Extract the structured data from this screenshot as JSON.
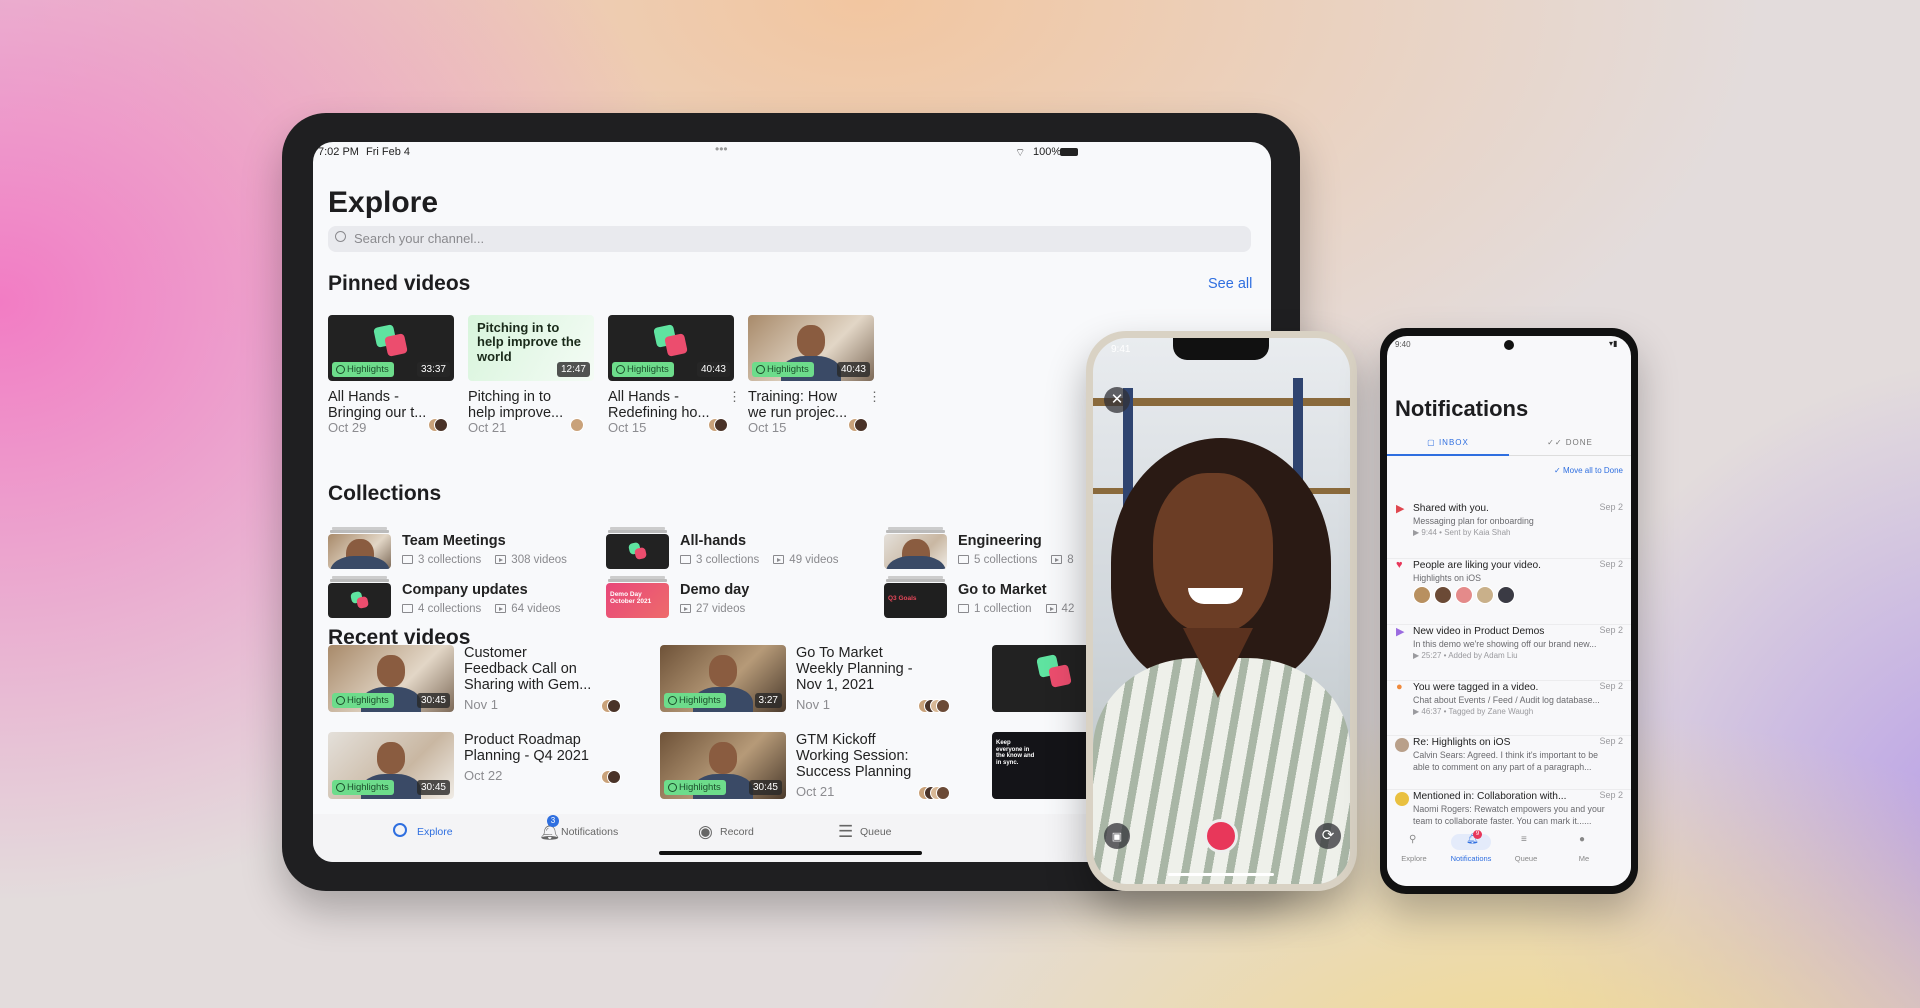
{
  "tablet": {
    "status": {
      "time": "7:02 PM",
      "date": "Fri Feb 4",
      "battery": "100%"
    },
    "title": "Explore",
    "search": {
      "placeholder": "Search your channel..."
    },
    "pinned": {
      "heading": "Pinned videos",
      "see_all": "See all",
      "items": [
        {
          "thumb": "logo",
          "badge": "Highlights",
          "duration": "33:37",
          "title": "All Hands -\nBringing our t...",
          "date": "Oct 29",
          "menu": false
        },
        {
          "thumb": "text",
          "thumb_text": "Pitching in to help improve the world",
          "duration": "12:47",
          "title": "Pitching in to\nhelp improve...",
          "date": "Oct 21",
          "menu": false
        },
        {
          "thumb": "logo",
          "badge": "Highlights",
          "duration": "40:43",
          "title": "All Hands -\nRedefining ho...",
          "date": "Oct 15",
          "menu": true
        },
        {
          "thumb": "photo",
          "badge": "Highlights",
          "duration": "40:43",
          "title": "Training: How\nwe run projec...",
          "date": "Oct 15",
          "menu": true
        }
      ]
    },
    "collections": {
      "heading": "Collections",
      "items": [
        {
          "name": "Team Meetings",
          "thumb": "photo",
          "collections": "3 collections",
          "videos": "308 videos"
        },
        {
          "name": "All-hands",
          "thumb": "logo",
          "collections": "3 collections",
          "videos": "49 videos"
        },
        {
          "name": "Engineering",
          "thumb": "photo-light",
          "collections": "5 collections",
          "videos": "8"
        },
        {
          "name": "Company updates",
          "thumb": "logo",
          "collections": "4 collections",
          "videos": "64 videos"
        },
        {
          "name": "Demo day",
          "thumb": "pink",
          "thumb_text": "Demo Day October 2021",
          "videos": "27 videos"
        },
        {
          "name": "Go to Market",
          "thumb": "dark-text",
          "thumb_text": "Q3 Goals",
          "collections": "1 collection",
          "videos": "42"
        }
      ]
    },
    "recent": {
      "heading": "Recent videos",
      "items": [
        {
          "thumb": "photo",
          "badge": "Highlights",
          "duration": "30:45",
          "title": "Customer\nFeedback Call on\nSharing with Gem...",
          "date": "Nov 1"
        },
        {
          "thumb": "photo-shelf",
          "badge": "Highlights",
          "duration": "3:27",
          "title": "Go To Market\nWeekly Planning -\nNov 1, 2021",
          "date": "Nov 1"
        },
        {
          "thumb": "logo"
        },
        {
          "thumb": "photo-light",
          "badge": "Highlights",
          "duration": "30:45",
          "title": "Product Roadmap\nPlanning - Q4 2021",
          "date": "Oct 22"
        },
        {
          "thumb": "photo-shelf",
          "badge": "Highlights",
          "duration": "30:45",
          "title": "GTM Kickoff\nWorking Session:\nSuccess Planning",
          "date": "Oct 21"
        },
        {
          "thumb": "promo",
          "thumb_text": "Keep everyone in the know and in sync."
        }
      ]
    },
    "tabbar": [
      {
        "label": "Explore",
        "icon": "search-icon",
        "active": true
      },
      {
        "label": "Notifications",
        "icon": "bell-icon",
        "badge": "3"
      },
      {
        "label": "Record",
        "icon": "record-icon"
      },
      {
        "label": "Queue",
        "icon": "queue-icon"
      }
    ],
    "accent": "#2f6fe0"
  },
  "iphone": {
    "time": "9:41",
    "record_color": "#e8375a"
  },
  "android": {
    "time": "9:40",
    "title": "Notifications",
    "tabs": [
      {
        "label": "INBOX",
        "active": true
      },
      {
        "label": "DONE"
      }
    ],
    "move_all": "Move all to Done",
    "items": [
      {
        "icon": "share-video-icon",
        "title": "Shared with you.",
        "date": "Sep 2",
        "body": "Messaging plan for onboarding",
        "meta": "▶ 9:44 • Sent by Kaia Shah"
      },
      {
        "icon": "heart-icon",
        "title": "People are liking your video.",
        "date": "Sep 2",
        "body": "Highlights on iOS",
        "avatars": 5
      },
      {
        "icon": "new-video-icon",
        "title": "New video in Product Demos",
        "date": "Sep 2",
        "body": "In this demo we're showing off our brand new...",
        "meta": "▶ 25:27 • Added by Adam Liu"
      },
      {
        "icon": "tag-person-icon",
        "title": "You were tagged in a video.",
        "date": "Sep 2",
        "body": "Chat about Events / Feed / Audit log database...",
        "meta": "▶ 46:37 • Tagged by Zane Waugh"
      },
      {
        "icon": "avatar",
        "title": "Re: Highlights on iOS",
        "date": "Sep 2",
        "body": "Calvin Sears: Agreed. I think it's important to be\nable to comment on any part of a paragraph..."
      },
      {
        "icon": "avatar",
        "title": "Mentioned in: Collaboration with...",
        "date": "Sep 2",
        "body": "Naomi Rogers: Rewatch empowers you and your\nteam to collaborate faster. You can mark it......"
      }
    ],
    "nav": [
      {
        "label": "Explore"
      },
      {
        "label": "Notifications",
        "active": true,
        "badge": "9"
      },
      {
        "label": "Queue"
      },
      {
        "label": "Me"
      }
    ]
  }
}
